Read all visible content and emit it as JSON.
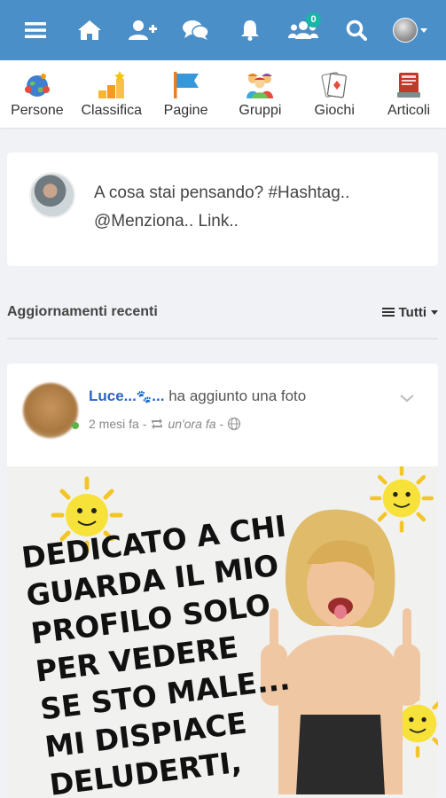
{
  "topbar": {
    "bg_color": "#4a8fc8",
    "icons": [
      "menu-icon",
      "home-icon",
      "add-friend-icon",
      "messages-icon",
      "bell-icon",
      "groups-icon",
      "search-icon",
      "avatar-menu"
    ],
    "groups_badge": "0"
  },
  "categories": [
    {
      "label": "Persone",
      "icon": "people-globe-icon"
    },
    {
      "label": "Classifica",
      "icon": "ranking-icon"
    },
    {
      "label": "Pagine",
      "icon": "flag-icon"
    },
    {
      "label": "Gruppi",
      "icon": "group-icon"
    },
    {
      "label": "Giochi",
      "icon": "cards-icon"
    },
    {
      "label": "Articoli",
      "icon": "articles-icon"
    }
  ],
  "composer": {
    "placeholder": "A cosa stai pensando? #Hashtag.. @Menziona.. Link.."
  },
  "feed": {
    "title": "Aggiornamenti recenti",
    "filter_label": "Tutti"
  },
  "post": {
    "author": "Luce...",
    "author_suffix": "...",
    "action": "ha aggiunto una foto",
    "time": "2 mesi fa",
    "shared_time": "un'ora fa",
    "image_text": "DEDICATO A CHI\nGUARDA IL MIO\nPROFILO SOLO\nPER VEDERE\nSE STO MALE...\nMI DISPIACE\nDELUDERTI,"
  },
  "colors": {
    "accent": "#4a8fc8",
    "badge": "#17b6a7",
    "author_link": "#2a64c7"
  }
}
